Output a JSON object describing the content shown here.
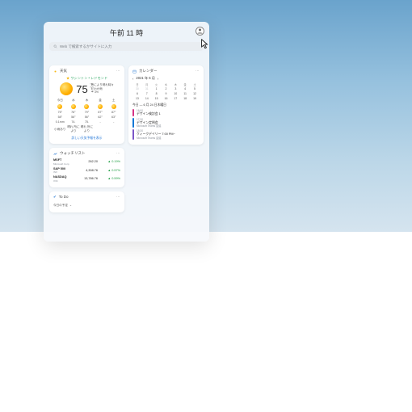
{
  "header": {
    "time": "午前 11 時",
    "search_placeholder": "Web で検索するかサイトに入力"
  },
  "weather": {
    "title": "天気",
    "location": "ワシントン • レドモンド",
    "temp": "75",
    "unit_f": "°F",
    "unit_c": "°C",
    "summary_l1": "所により晴れ時々",
    "summary_l2": "にわか雨",
    "rain_pct": "3%",
    "forecast": {
      "days": [
        "今日",
        "水",
        "木",
        "金",
        "土"
      ],
      "highs": [
        "75°",
        "76°",
        "79°",
        "87°",
        "87°"
      ],
      "lows": [
        "58°",
        "56°",
        "56°",
        "62°",
        "63°"
      ],
      "extra": [
        "0.1mm",
        "74.",
        "75.",
        "-",
        "-"
      ],
      "captions": [
        "小雨あり",
        "晴れ 所により",
        "晴れ 所により",
        "",
        ""
      ]
    },
    "more": "詳しい天気予報を表示"
  },
  "calendar": {
    "title": "カレンダー",
    "month": "2021 年 6 月",
    "wdays": [
      "日",
      "月",
      "火",
      "水",
      "木",
      "金",
      "土"
    ],
    "grid": [
      [
        "30",
        "31",
        "1",
        "2",
        "3",
        "4",
        "5"
      ],
      [
        "6",
        "7",
        "8",
        "9",
        "10",
        "11",
        "12"
      ],
      [
        "13",
        "14",
        "15",
        "16",
        "17",
        "18",
        "19"
      ]
    ],
    "agenda_header": "今日 — 6 月 24 日木曜日",
    "events": [
      {
        "color": "#d63384",
        "time": "16:00",
        "title": "デザイン検討会 1",
        "meta": ""
      },
      {
        "color": "#1278d6",
        "time": "17:30",
        "title": "デザイン定例会",
        "meta": "Microsoft Teams 会議"
      },
      {
        "color": "#7a56c7",
        "time": "18:30",
        "title": "クィークデイリー 7:00 PM~",
        "meta": "Microsoft Teams 会議"
      }
    ]
  },
  "finance": {
    "title": "ウォッチリスト",
    "rows": [
      {
        "symbol": "MSFT",
        "name": "Microsoft Corp",
        "price": "262.20",
        "change": "▲ 0.19%"
      },
      {
        "symbol": "S&P 500",
        "name": "INX",
        "price": "4,308.76",
        "change": "▲ 0.57%"
      },
      {
        "symbol": "NASDAQ",
        "name": "IXIC",
        "price": "13,786.76",
        "change": "▲ 0.59%"
      }
    ]
  },
  "todo": {
    "title": "To Do",
    "body": "今日の予定"
  }
}
